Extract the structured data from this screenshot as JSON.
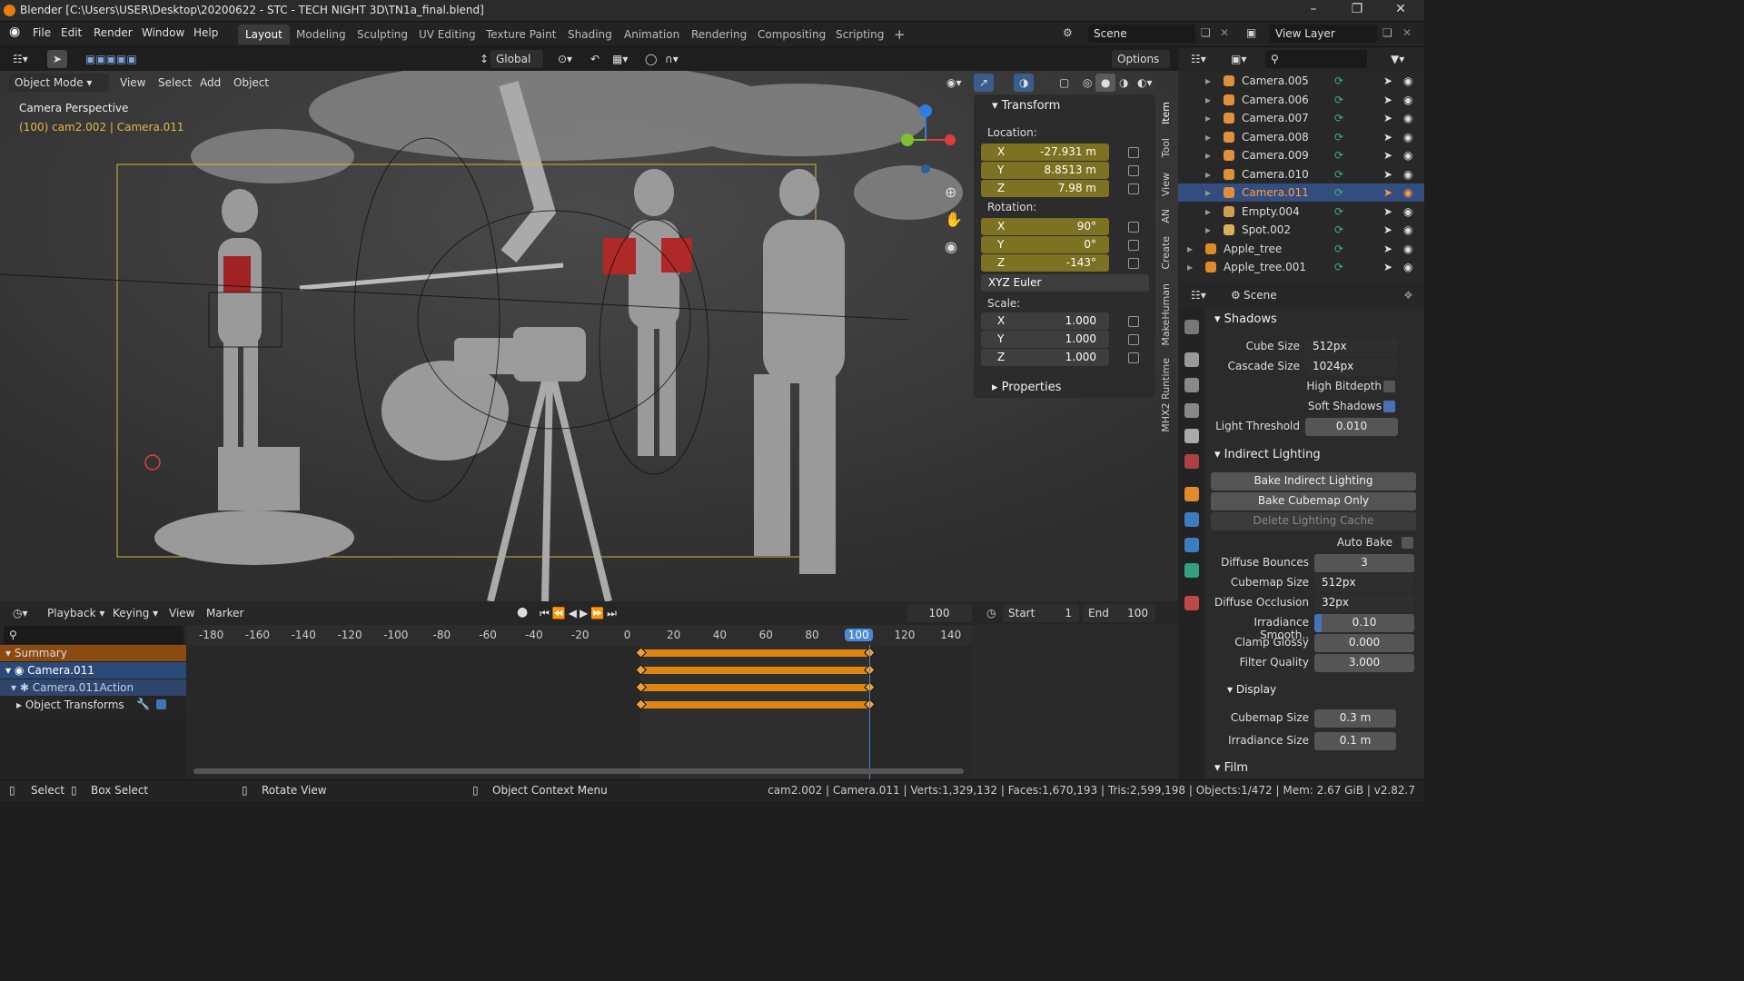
{
  "title": "Blender [C:\\Users\\USER\\Desktop\\20200622 - STC - TECH NIGHT 3D\\TN1a_final.blend]",
  "menu": [
    "File",
    "Edit",
    "Render",
    "Window",
    "Help"
  ],
  "workspaces": [
    "Layout",
    "Modeling",
    "Sculpting",
    "UV Editing",
    "Texture Paint",
    "Shading",
    "Animation",
    "Rendering",
    "Compositing",
    "Scripting"
  ],
  "scene": "Scene",
  "view_layer": "View Layer",
  "vp_header": {
    "orientation": "Global",
    "options": "Options",
    "mode": "Object Mode",
    "menus": [
      "View",
      "Select",
      "Add",
      "Object"
    ]
  },
  "viewport": {
    "perspective": "Camera Perspective",
    "info": "(100) cam2.002 | Camera.011"
  },
  "npanel": {
    "transform": "Transform",
    "location_label": "Location:",
    "location": {
      "x": "-27.931 m",
      "y": "8.8513 m",
      "z": "7.98 m"
    },
    "rotation_label": "Rotation:",
    "rotation": {
      "x": "90°",
      "y": "0°",
      "z": "-143°"
    },
    "rotation_mode": "XYZ Euler",
    "scale_label": "Scale:",
    "scale": {
      "x": "1.000",
      "y": "1.000",
      "z": "1.000"
    },
    "properties": "Properties",
    "axes": {
      "x": "X",
      "y": "Y",
      "z": "Z"
    },
    "tabs": [
      "Item",
      "Tool",
      "View",
      "AN",
      "Create",
      "MakeHuman",
      "MHX2 Runtime"
    ]
  },
  "outliner": [
    {
      "name": "Camera.005",
      "type": "camera"
    },
    {
      "name": "Camera.006",
      "type": "camera"
    },
    {
      "name": "Camera.007",
      "type": "camera"
    },
    {
      "name": "Camera.008",
      "type": "camera"
    },
    {
      "name": "Camera.009",
      "type": "camera"
    },
    {
      "name": "Camera.010",
      "type": "camera"
    },
    {
      "name": "Camera.011",
      "type": "camera",
      "selected": true
    },
    {
      "name": "Empty.004",
      "type": "empty"
    },
    {
      "name": "Spot.002",
      "type": "light"
    },
    {
      "name": "Apple_tree",
      "type": "mesh"
    },
    {
      "name": "Apple_tree.001",
      "type": "mesh"
    }
  ],
  "props": {
    "context": "Scene",
    "shadows": {
      "title": "Shadows",
      "cube_size_label": "Cube Size",
      "cube_size": "512px",
      "cascade_size_label": "Cascade Size",
      "cascade_size": "1024px",
      "high_bitdepth": "High Bitdepth",
      "soft_shadows": "Soft Shadows",
      "light_threshold_label": "Light Threshold",
      "light_threshold": "0.010"
    },
    "indirect": {
      "title": "Indirect Lighting",
      "bake_indirect": "Bake Indirect Lighting",
      "bake_cubemap": "Bake Cubemap Only",
      "delete_cache": "Delete Lighting Cache",
      "auto_bake": "Auto Bake",
      "diffuse_bounces_label": "Diffuse Bounces",
      "diffuse_bounces": "3",
      "cubemap_size_label": "Cubemap Size",
      "cubemap_size": "512px",
      "diffuse_occlusion_label": "Diffuse Occlusion",
      "diffuse_occlusion": "32px",
      "irradiance_smooth_label": "Irradiance Smooth..",
      "irradiance_smooth": "0.10",
      "clamp_glossy_label": "Clamp Glossy",
      "clamp_glossy": "0.000",
      "filter_quality_label": "Filter Quality",
      "filter_quality": "3.000"
    },
    "display": {
      "title": "Display",
      "cubemap_size_label": "Cubemap Size",
      "cubemap_size": "0.3 m",
      "irradiance_size_label": "Irradiance Size",
      "irradiance_size": "0.1 m"
    },
    "film": "Film"
  },
  "timeline": {
    "menus": [
      "Playback",
      "Keying",
      "View",
      "Marker"
    ],
    "current_frame": "100",
    "start_label": "Start",
    "start": "1",
    "end_label": "End",
    "end": "100",
    "ruler": [
      "-180",
      "-160",
      "-140",
      "-120",
      "-100",
      "-80",
      "-60",
      "-40",
      "-20",
      "0",
      "20",
      "40",
      "60",
      "80",
      "100",
      "120",
      "140"
    ],
    "channels": [
      "Summary",
      "Camera.011",
      "Camera.011Action",
      "Object Transforms"
    ]
  },
  "status": {
    "select": "Select",
    "box_select": "Box Select",
    "rotate": "Rotate View",
    "context_menu": "Object Context Menu",
    "stats": "cam2.002 | Camera.011 | Verts:1,329,132 | Faces:1,670,193 | Tris:2,599,198 | Objects:1/472 | Mem: 2.67 GiB | v2.82.7"
  }
}
